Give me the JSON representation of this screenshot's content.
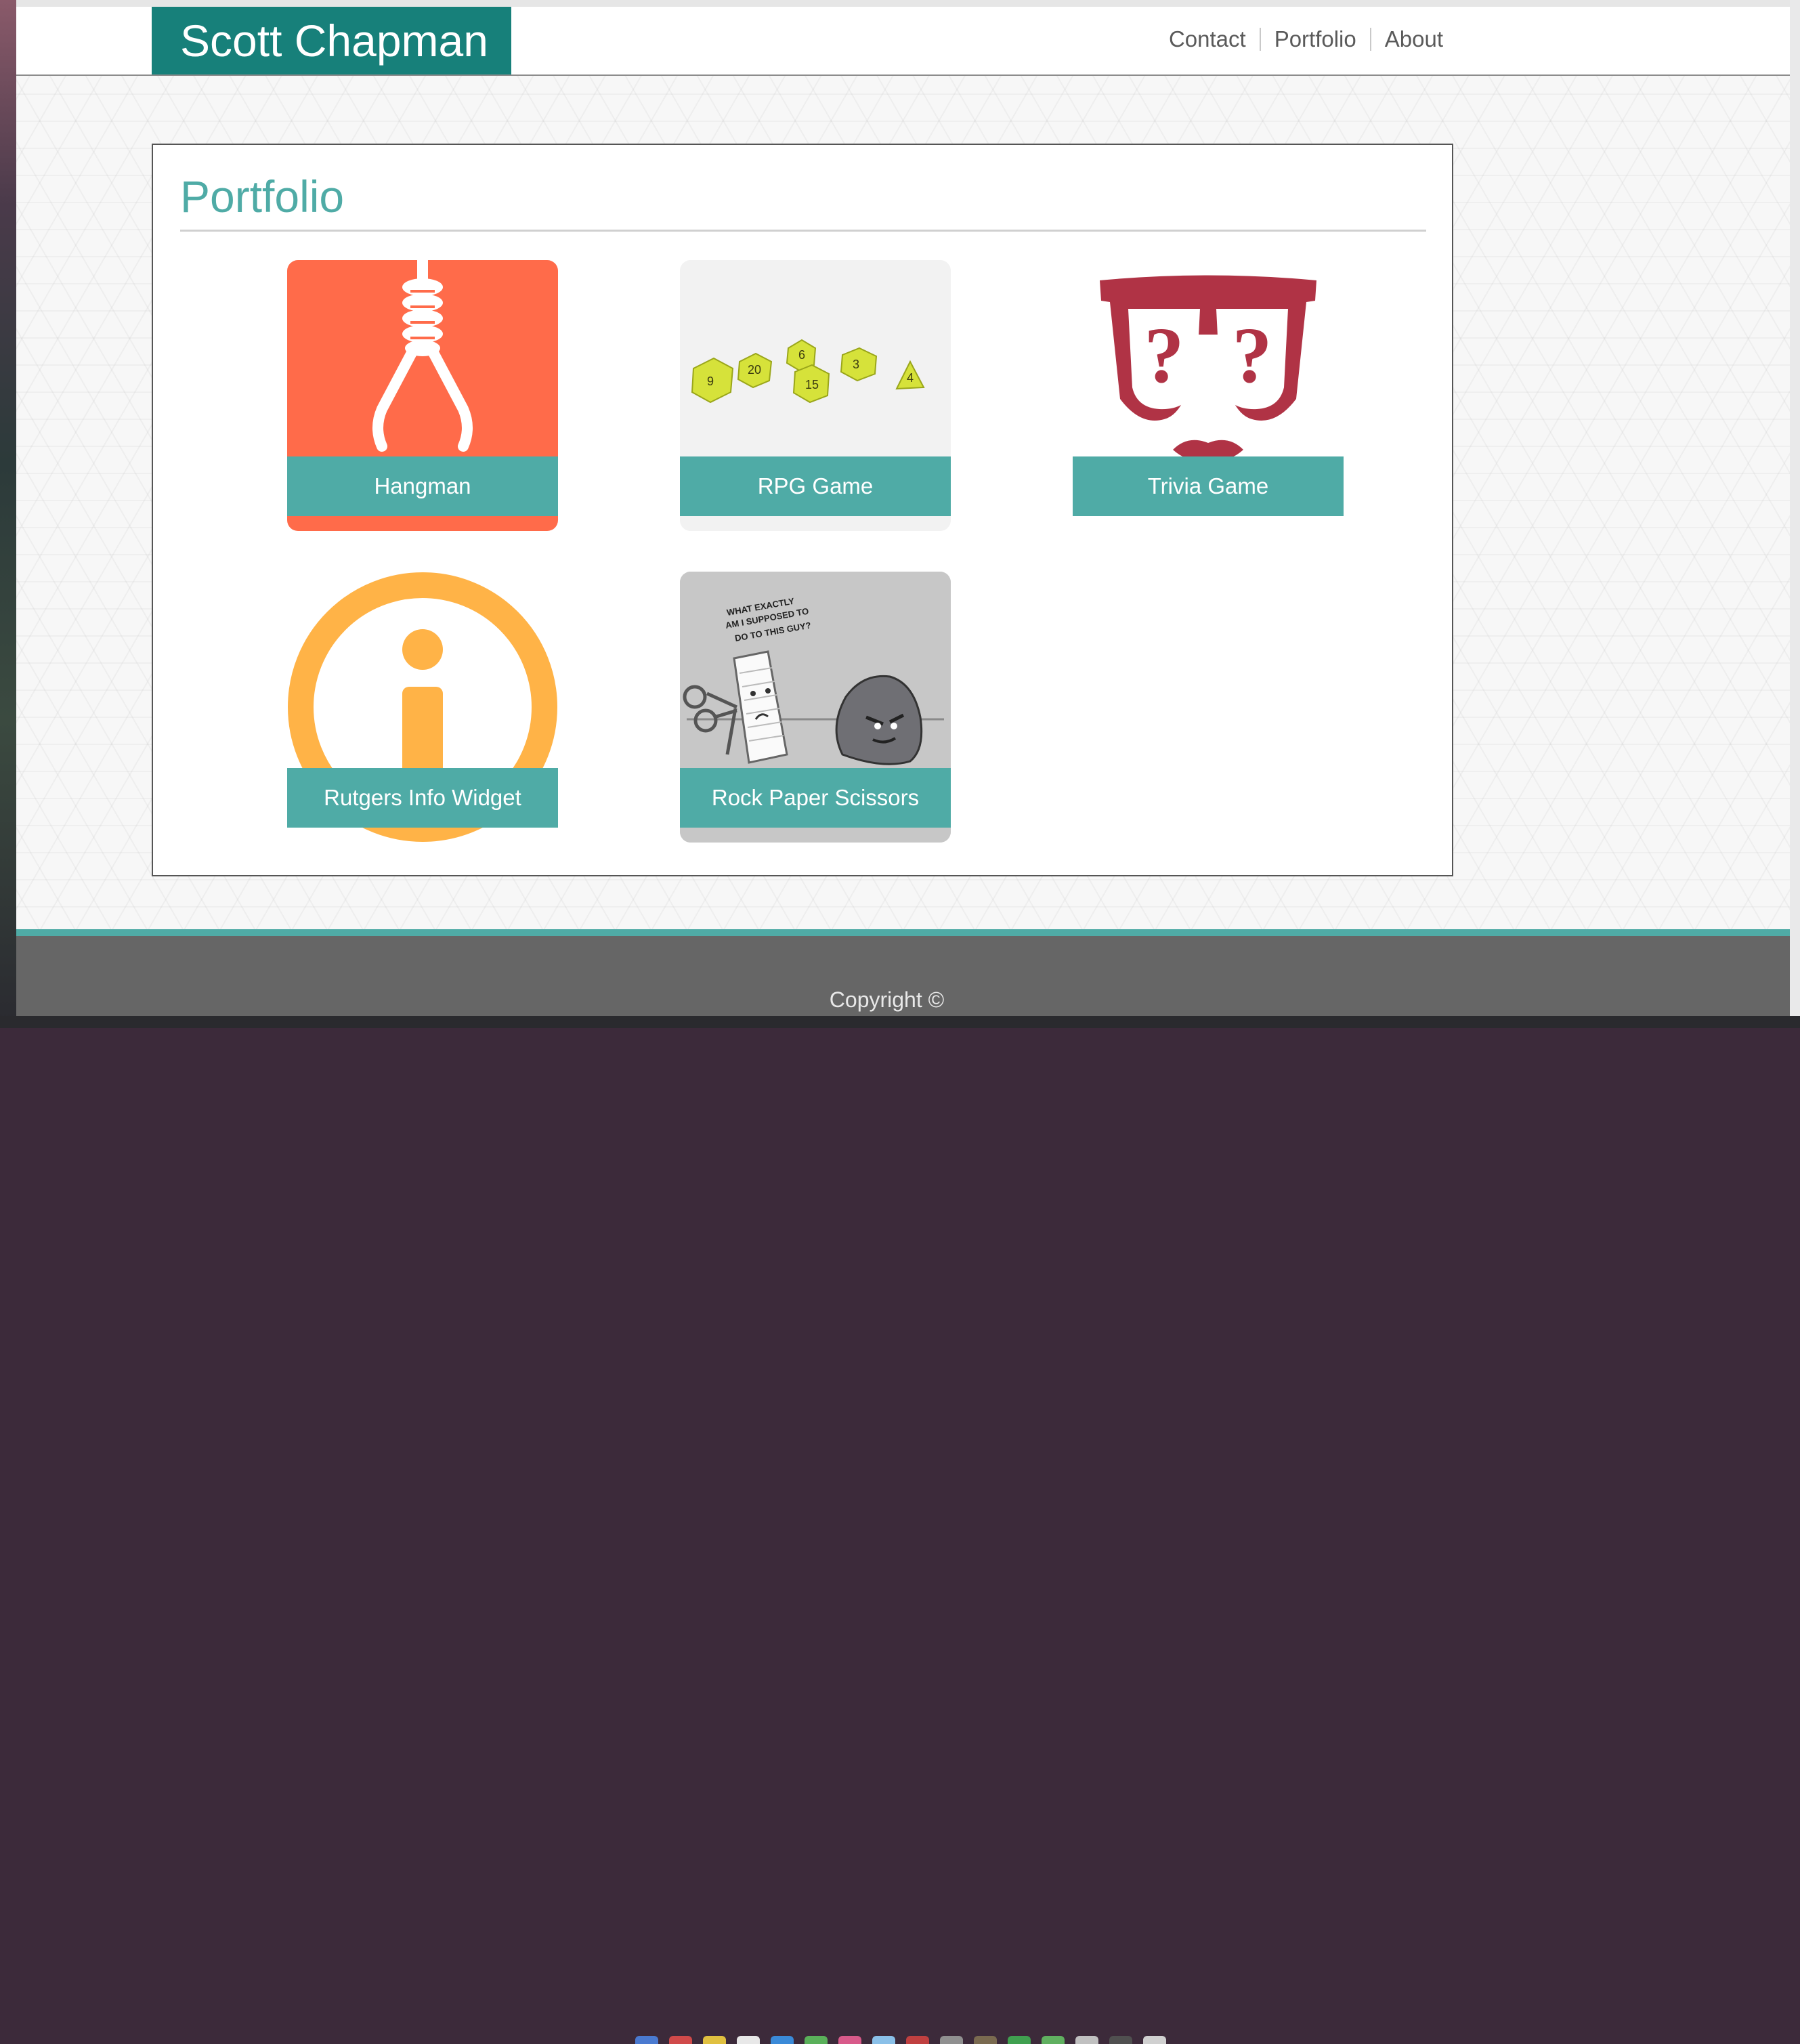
{
  "header": {
    "brand": "Scott Chapman",
    "nav": [
      "Contact",
      "Portfolio",
      "About"
    ]
  },
  "main": {
    "title": "Portfolio",
    "projects": [
      {
        "label": "Hangman",
        "icon": "noose-icon",
        "color": "#ff6b4a"
      },
      {
        "label": "RPG Game",
        "icon": "dice-image",
        "color": "#f2f2f2"
      },
      {
        "label": "Trivia Game",
        "icon": "question-glasses-icon",
        "color": "#b03345"
      },
      {
        "label": "Rutgers Info Widget",
        "icon": "info-icon",
        "color": "#ffb347"
      },
      {
        "label": "Rock Paper Scissors",
        "icon": "rock-paper-scissors-comic",
        "color": "#c7c7c7"
      }
    ],
    "comic_caption": "WHAT EXACTLY AM I SUPPOSED TO DO TO THIS GUY?"
  },
  "footer": {
    "copyright": "Copyright ©"
  },
  "colors": {
    "accent": "#4faba6",
    "brand": "#17807a",
    "footer": "#666666"
  }
}
